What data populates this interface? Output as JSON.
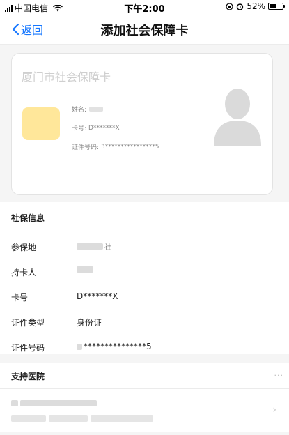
{
  "status_bar": {
    "carrier": "中国电信",
    "time": "下午2:00",
    "battery": "52%",
    "battery_level": 0.52
  },
  "nav": {
    "back_label": "返回",
    "title": "添加社会保障卡"
  },
  "card": {
    "title": "厦门市社会保障卡",
    "name_label": "姓名:",
    "card_no_label": "卡号:",
    "card_no_value": "D*******X",
    "id_label": "证件号码:",
    "id_value": "3****************5"
  },
  "social_info": {
    "header": "社保信息",
    "rows": [
      {
        "key": "参保地",
        "value": ""
      },
      {
        "key": "持卡人",
        "value": ""
      },
      {
        "key": "卡号",
        "value": "D*******X"
      },
      {
        "key": "证件类型",
        "value": "身份证"
      },
      {
        "key": "证件号码",
        "value": "***************5"
      }
    ]
  },
  "hospitals": {
    "header": "支持医院",
    "more_icon": "ellipsis-icon"
  },
  "colors": {
    "accent": "#1677ff",
    "chip": "#ffe79a",
    "band": "#f5f5f5"
  }
}
